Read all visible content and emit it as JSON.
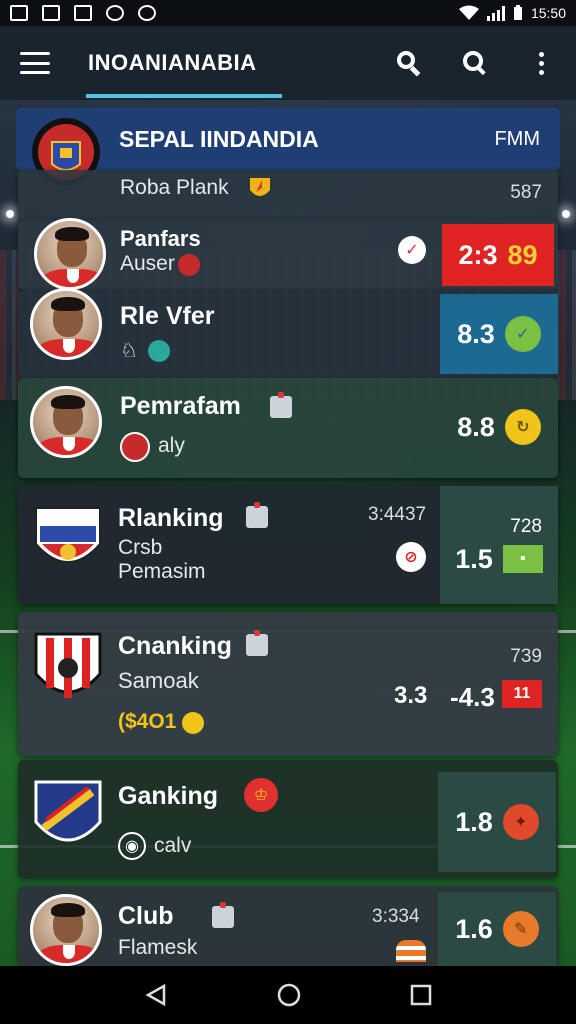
{
  "status_bar": {
    "time": "15:50"
  },
  "app_bar": {
    "title": "INOANIANABIA"
  },
  "header": {
    "title": "SEPAL IINDANDIA",
    "tag": "FMM"
  },
  "rows": [
    {
      "name": "",
      "subtitle": "Roba Plank",
      "score": "",
      "meta": "587"
    },
    {
      "name": "Panfars",
      "subtitle": "Auser",
      "score": "2:3",
      "score_badge": "89",
      "color": "#e02424"
    },
    {
      "name": "Rle Vfer",
      "subtitle": "",
      "score": "8.3"
    },
    {
      "name": "Pemrafam",
      "subtitle": "aly",
      "score": "8.8"
    },
    {
      "name": "Rlanking",
      "subtitle": "Crsb",
      "subtitle2": "Pemasim",
      "time": "3:4437",
      "meta": "728",
      "score": "1.5"
    },
    {
      "name": "Cnanking",
      "subtitle": "Samoak",
      "extra": "($4O1",
      "meta": "739",
      "score_prefix": "3.3",
      "score": "-4.3",
      "score_badge": "11"
    },
    {
      "name": "Ganking",
      "subtitle": "calv",
      "score": "1.8"
    },
    {
      "name": "Club",
      "subtitle": "Flamesk",
      "time": "3:334",
      "score": "1.6"
    }
  ],
  "colors": {
    "appbar": "#1a242e",
    "header": "#1f3f74",
    "accent": "#56c6e8",
    "red": "#e02424",
    "blue": "#1c6a92",
    "lime": "#7ac043",
    "yellow": "#f0c419",
    "orange": "#e8792a"
  },
  "icons": [
    "wifi-icon",
    "signal-icon",
    "battery-icon",
    "menu-icon",
    "search-icon",
    "search-outline-icon",
    "more-vert-icon",
    "back-icon",
    "home-icon",
    "recents-icon"
  ]
}
